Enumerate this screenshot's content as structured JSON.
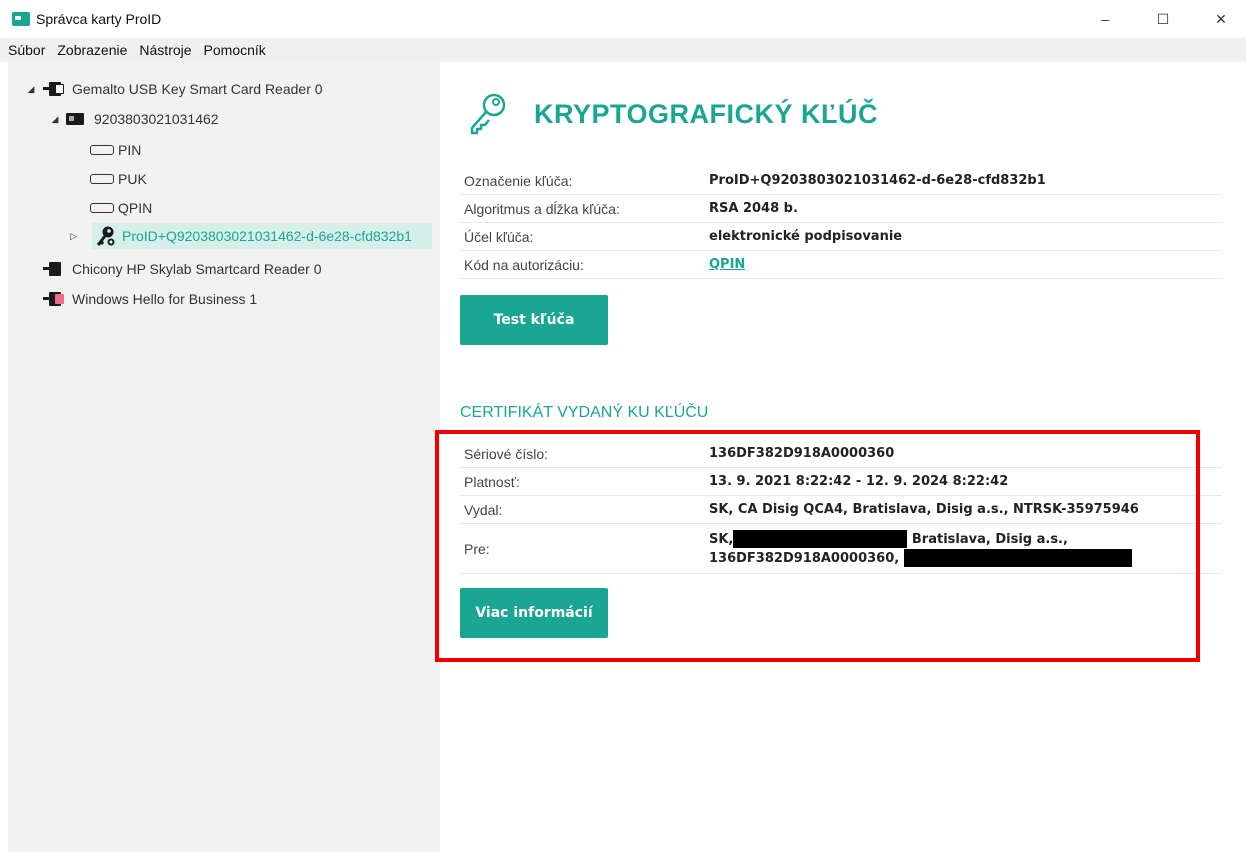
{
  "window": {
    "title": "Správca karty ProID",
    "minimize": "–",
    "maximize": "☐",
    "close": "✕"
  },
  "menu": [
    "Súbor",
    "Zobrazenie",
    "Nástroje",
    "Pomocník"
  ],
  "tree": {
    "reader1": "Gemalto USB Key Smart Card Reader 0",
    "card": "9203803021031462",
    "pin": "PIN",
    "puk": "PUK",
    "qpin": "QPIN",
    "key": "ProID+Q9203803021031462-d-6e28-cfd832b1",
    "reader2": "Chicony HP Skylab Smartcard Reader 0",
    "reader3": "Windows Hello for Business 1"
  },
  "content": {
    "title": "KRYPTOGRAFICKÝ KĽÚČ",
    "key_props": [
      {
        "label": "Označenie kľúča:",
        "value": "ProID+Q9203803021031462-d-6e28-cfd832b1"
      },
      {
        "label": "Algoritmus a dĺžka kľúča:",
        "value": "RSA 2048 b."
      },
      {
        "label": "Účel kľúča:",
        "value": "elektronické podpisovanie"
      },
      {
        "label": "Kód na autorizáciu:",
        "value": "QPIN"
      }
    ],
    "test_button": "Test kľúča",
    "cert_title": "CERTIFIKÁT VYDANÝ KU KĽÚČU",
    "cert_props": [
      {
        "label": "Sériové číslo:",
        "value": "136DF382D918A0000360"
      },
      {
        "label": "Platnosť:",
        "value": "13. 9. 2021 8:22:42 - 12. 9. 2024 8:22:42"
      },
      {
        "label": "Vydal:",
        "value": "SK, CA Disig QCA4, Bratislava, Disig a.s., NTRSK-35975946"
      },
      {
        "label": "Pre:",
        "value_parts": [
          "SK,",
          " Bratislava, Disig a.s.,",
          "136DF382D918A0000360,"
        ]
      }
    ],
    "more_button": "Viac informácií"
  },
  "colors": {
    "accent": "#1aa692",
    "highlight": "#ee0000"
  }
}
